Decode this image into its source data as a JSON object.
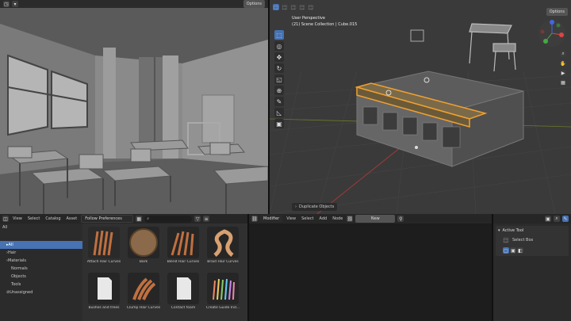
{
  "left_viewport": {
    "options_label": "Options"
  },
  "right_viewport": {
    "options_label": "Options",
    "view_name": "User Perspective",
    "collection_info": "(21) Scene Collection | Cube.015",
    "operator_panel": "Duplicate Objects"
  },
  "asset_browser": {
    "editor_icon": "asset-browser-icon",
    "menus": [
      "View",
      "Select",
      "Catalog",
      "Asset"
    ],
    "library_select": "Follow Preferences",
    "search_placeholder": "",
    "filter_value": "All",
    "catalogs": [
      {
        "label": "All",
        "selected": true
      },
      {
        "label": "Hair",
        "expandable": true
      },
      {
        "label": "Materials",
        "expandable": true
      },
      {
        "label": "Normals"
      },
      {
        "label": "Objects"
      },
      {
        "label": "Tools"
      },
      {
        "label": "Unassigned"
      }
    ],
    "assets": [
      {
        "name": "Attach Hair Curves",
        "kind": "hair"
      },
      {
        "name": "Bark",
        "kind": "bark"
      },
      {
        "name": "Blend Hair Curves",
        "kind": "hair"
      },
      {
        "name": "Braid Hair Curves",
        "kind": "braid"
      },
      {
        "name": "Bushes and trees",
        "kind": "doc"
      },
      {
        "name": "Clump Hair Curves",
        "kind": "clump"
      },
      {
        "name": "Contact foam",
        "kind": "doc"
      },
      {
        "name": "Create Guide Ind...",
        "kind": "guides"
      }
    ]
  },
  "node_editor": {
    "mode": "Modifier",
    "menus": [
      "View",
      "Select",
      "Add",
      "Node"
    ],
    "new_button": "New"
  },
  "properties": {
    "panel_title": "Active Tool",
    "tool_name": "Select Box"
  },
  "colors": {
    "accent": "#4772b3",
    "selection_outline": "#f0a030",
    "viewport_grid": "#3a3a3a"
  }
}
